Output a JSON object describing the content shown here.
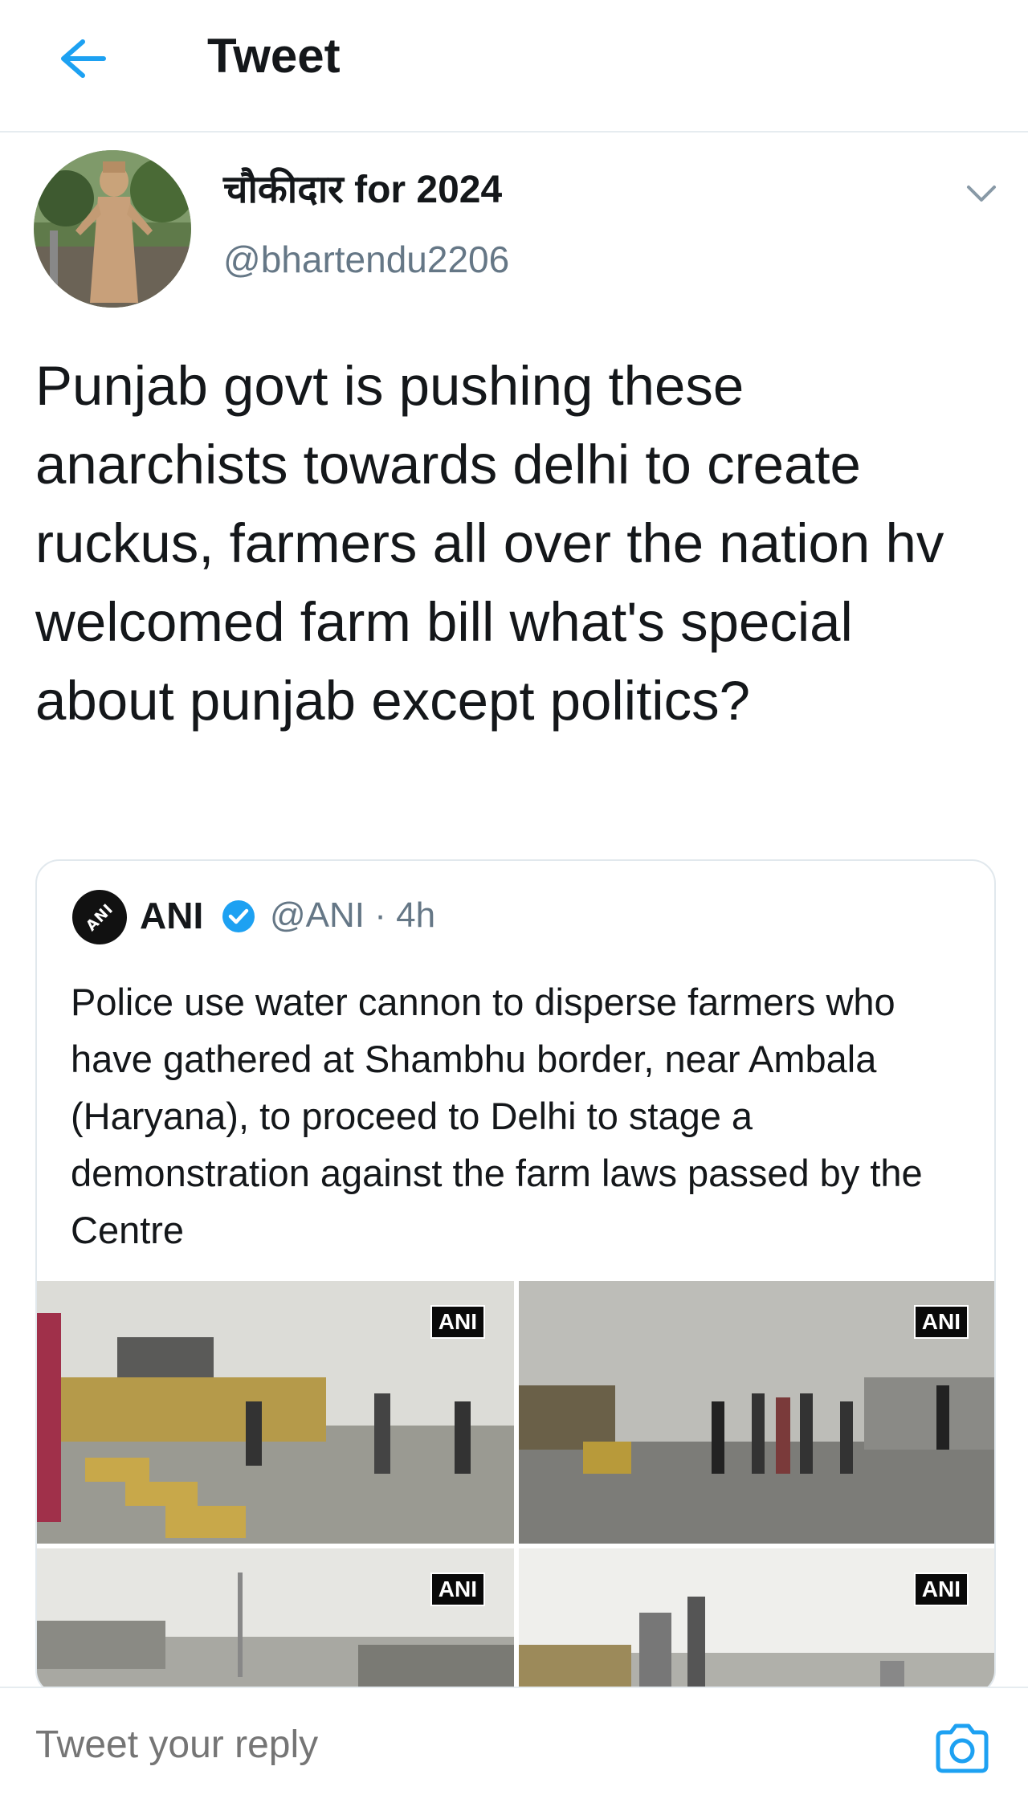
{
  "header": {
    "title": "Tweet",
    "back_icon": "back-arrow-icon",
    "accent": "#1da1f2"
  },
  "author": {
    "display_name": "चौकीदार for 2024",
    "handle": "@bhartendu2206",
    "avatar_icon": "avatar-statue-photo"
  },
  "tweet": {
    "text": "Punjab govt is pushing these anarchists towards delhi to create ruckus, farmers all over the nation hv welcomed farm bill what's special about punjab except politics?"
  },
  "quoted": {
    "logo_text": "ANI",
    "name": "ANI",
    "verified": true,
    "handle_time": "@ANI · 4h",
    "text": "Police use water cannon to disperse farmers who have gathered at Shambhu border, near Ambala (Haryana), to proceed to Delhi to stage a demonstration against the farm laws passed by the Centre",
    "media": [
      {
        "watermark": "ANI"
      },
      {
        "watermark": "ANI"
      },
      {
        "watermark": "ANI"
      },
      {
        "watermark": "ANI"
      }
    ]
  },
  "reply": {
    "placeholder": "Tweet your reply",
    "camera_icon": "camera-icon"
  },
  "colors": {
    "text": "#14171a",
    "secondary": "#657786",
    "border": "#e1e8ed",
    "verified": "#1da1f2"
  }
}
